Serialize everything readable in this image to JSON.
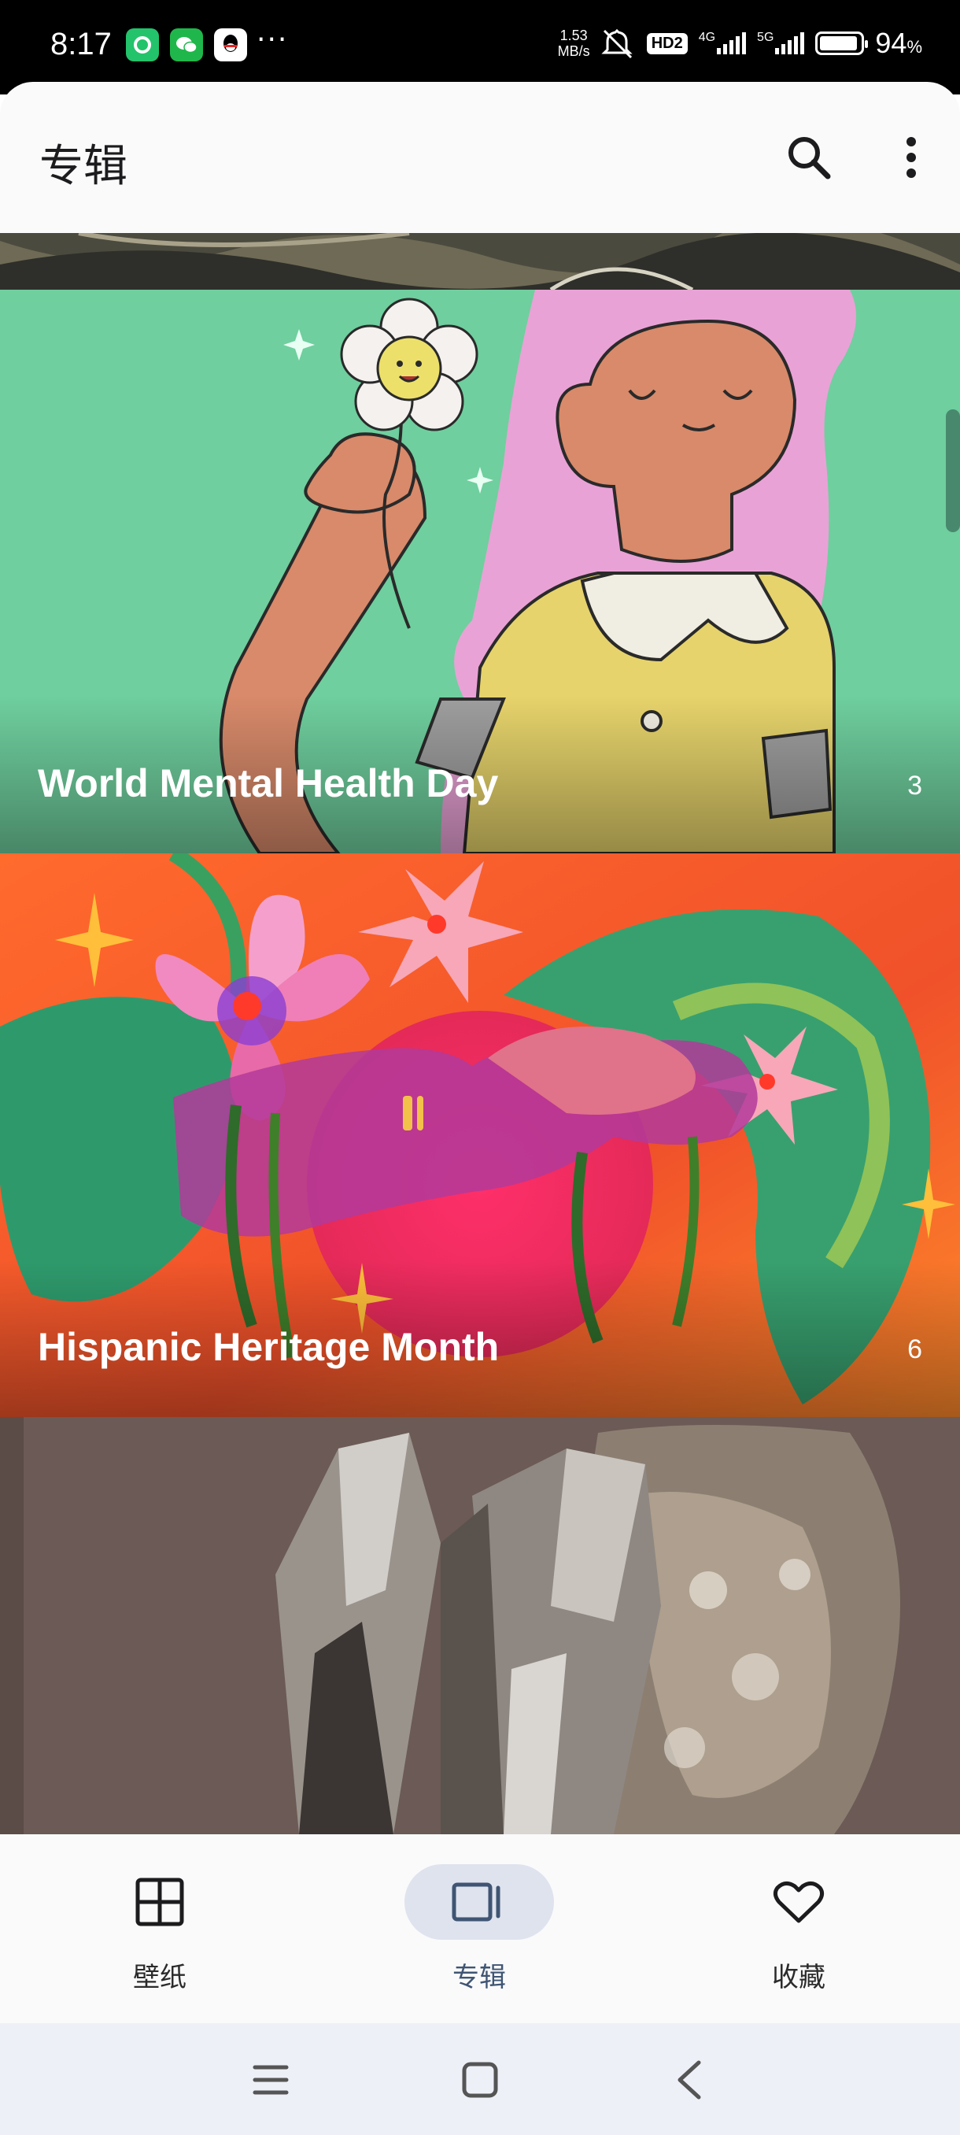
{
  "status_bar": {
    "time": "8:17",
    "speed_value": "1.53",
    "speed_unit": "MB/s",
    "hd_badge": "HD2",
    "net1": "4G",
    "net2": "5G",
    "battery_pct": "94",
    "battery_symbol": "%",
    "battery_level": 0.94,
    "more_dots": "···"
  },
  "header": {
    "title": "专辑",
    "search_icon": "search-icon",
    "more_icon": "more-vertical-icon"
  },
  "albums": [
    {
      "name": "World Mental Health Day",
      "count": "3"
    },
    {
      "name": "Hispanic Heritage Month",
      "count": "6"
    }
  ],
  "bottom_nav": {
    "items": [
      {
        "label": "壁纸",
        "icon": "grid-icon",
        "active": false
      },
      {
        "label": "专辑",
        "icon": "album-icon",
        "active": true
      },
      {
        "label": "收藏",
        "icon": "heart-icon",
        "active": false
      }
    ]
  },
  "system_nav": {
    "menu_icon": "menu-icon",
    "home_icon": "home-icon",
    "back_icon": "back-icon"
  },
  "colors": {
    "mental_health_bg": "#6fcf9e",
    "heritage_bg": "#ef4a2b",
    "crystal_bg": "#6b5a55",
    "active_nav_pill": "#dfe3ee",
    "active_nav_text": "#3f5573"
  }
}
